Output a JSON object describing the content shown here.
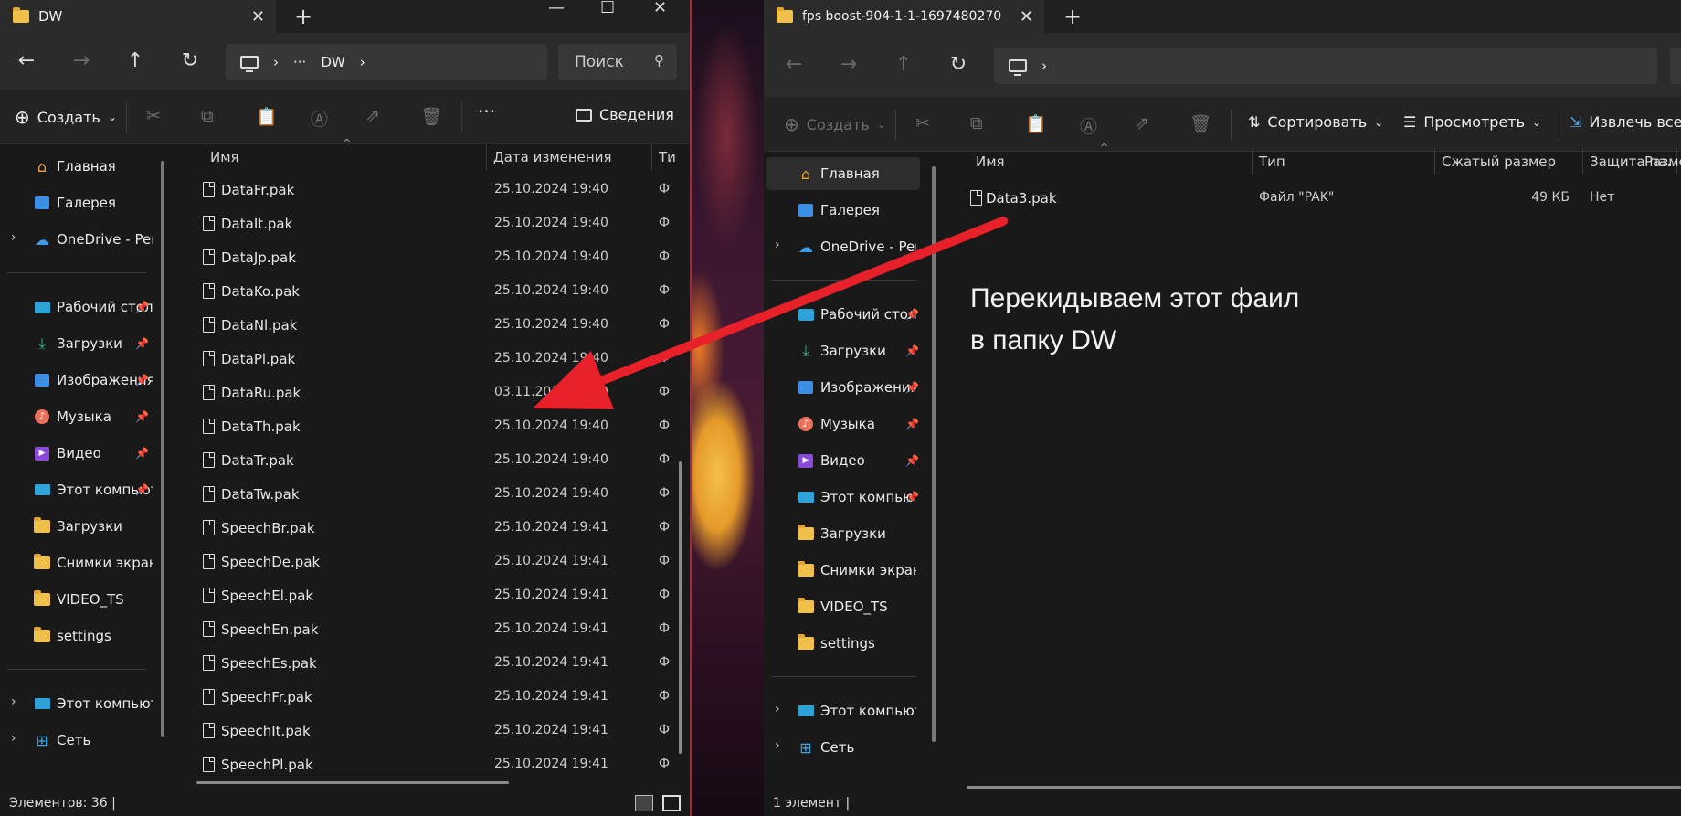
{
  "left": {
    "tab_title": "DW",
    "breadcrumb": {
      "ellipsis": "···",
      "folder": "DW"
    },
    "search_placeholder": "Поиск",
    "toolbar": {
      "create": "Создать",
      "more": "···",
      "details": "Сведения"
    },
    "nav": [
      {
        "label": "Главная",
        "icon": "home-icon"
      },
      {
        "label": "Галерея",
        "icon": "gallery-icon"
      },
      {
        "label": "OneDrive - Personal",
        "icon": "cloud-icon"
      },
      {
        "label": "Рабочий стол",
        "icon": "desktop-icon"
      },
      {
        "label": "Загрузки",
        "icon": "download-icon"
      },
      {
        "label": "Изображения",
        "icon": "pictures-icon"
      },
      {
        "label": "Музыка",
        "icon": "music-icon"
      },
      {
        "label": "Видео",
        "icon": "video-icon"
      },
      {
        "label": "Этот компьютер",
        "icon": "monitor-icon"
      },
      {
        "label": "Загрузки",
        "icon": "folder-icon"
      },
      {
        "label": "Снимки экрана",
        "icon": "folder-icon"
      },
      {
        "label": "VIDEO_TS",
        "icon": "folder-icon"
      },
      {
        "label": "settings",
        "icon": "folder-icon"
      },
      {
        "label": "Этот компьютер",
        "icon": "monitor-icon"
      },
      {
        "label": "Сеть",
        "icon": "network-icon"
      }
    ],
    "columns": {
      "name": "Имя",
      "date": "Дата изменения",
      "type": "Ти"
    },
    "files": [
      {
        "name": "DataFr.pak",
        "date": "25.10.2024 19:40",
        "type": "Ф"
      },
      {
        "name": "DataIt.pak",
        "date": "25.10.2024 19:40",
        "type": "Ф"
      },
      {
        "name": "DataJp.pak",
        "date": "25.10.2024 19:40",
        "type": "Ф"
      },
      {
        "name": "DataKo.pak",
        "date": "25.10.2024 19:40",
        "type": "Ф"
      },
      {
        "name": "DataNl.pak",
        "date": "25.10.2024 19:40",
        "type": "Ф"
      },
      {
        "name": "DataPl.pak",
        "date": "25.10.2024 19:40",
        "type": "Ф"
      },
      {
        "name": "DataRu.pak",
        "date": "03.11.2024 19:09",
        "type": "Ф"
      },
      {
        "name": "DataTh.pak",
        "date": "25.10.2024 19:40",
        "type": "Ф"
      },
      {
        "name": "DataTr.pak",
        "date": "25.10.2024 19:40",
        "type": "Ф"
      },
      {
        "name": "DataTw.pak",
        "date": "25.10.2024 19:40",
        "type": "Ф"
      },
      {
        "name": "SpeechBr.pak",
        "date": "25.10.2024 19:41",
        "type": "Ф"
      },
      {
        "name": "SpeechDe.pak",
        "date": "25.10.2024 19:41",
        "type": "Ф"
      },
      {
        "name": "SpeechEl.pak",
        "date": "25.10.2024 19:41",
        "type": "Ф"
      },
      {
        "name": "SpeechEn.pak",
        "date": "25.10.2024 19:41",
        "type": "Ф"
      },
      {
        "name": "SpeechEs.pak",
        "date": "25.10.2024 19:41",
        "type": "Ф"
      },
      {
        "name": "SpeechFr.pak",
        "date": "25.10.2024 19:41",
        "type": "Ф"
      },
      {
        "name": "SpeechIt.pak",
        "date": "25.10.2024 19:41",
        "type": "Ф"
      },
      {
        "name": "SpeechPl.pak",
        "date": "25.10.2024 19:41",
        "type": "Ф"
      }
    ],
    "status": "Элементов: 36  |"
  },
  "right": {
    "tab_title": "fps boost-904-1-1-1697480270",
    "toolbar": {
      "create": "Создать",
      "sort": "Сортировать",
      "view": "Просмотреть",
      "extract": "Извлечь все"
    },
    "nav": [
      {
        "label": "Главная",
        "icon": "home-icon"
      },
      {
        "label": "Галерея",
        "icon": "gallery-icon"
      },
      {
        "label": "OneDrive - Personal",
        "icon": "cloud-icon"
      },
      {
        "label": "Рабочий стол",
        "icon": "desktop-icon"
      },
      {
        "label": "Загрузки",
        "icon": "download-icon"
      },
      {
        "label": "Изображения",
        "icon": "pictures-icon"
      },
      {
        "label": "Музыка",
        "icon": "music-icon"
      },
      {
        "label": "Видео",
        "icon": "video-icon"
      },
      {
        "label": "Этот компьютер",
        "icon": "monitor-icon"
      },
      {
        "label": "Загрузки",
        "icon": "folder-icon"
      },
      {
        "label": "Снимки экрана",
        "icon": "folder-icon"
      },
      {
        "label": "VIDEO_TS",
        "icon": "folder-icon"
      },
      {
        "label": "settings",
        "icon": "folder-icon"
      },
      {
        "label": "Этот компьютер",
        "icon": "monitor-icon"
      },
      {
        "label": "Сеть",
        "icon": "network-icon"
      }
    ],
    "columns": {
      "name": "Имя",
      "type": "Тип",
      "size": "Сжатый размер",
      "protect": "Защита па...",
      "size2": "Разме"
    },
    "files": [
      {
        "name": "Data3.pak",
        "type": "Файл \"PAK\"",
        "size": "49 КБ",
        "protect": "Нет"
      }
    ],
    "status": "1 элемент  |"
  },
  "annotation": {
    "line1": "Перекидываем этот фаил",
    "line2": "в папку DW",
    "color": "#e8202a"
  }
}
